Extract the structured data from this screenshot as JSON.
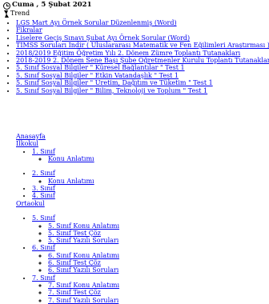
{
  "header": {
    "date": "Cuma , 5 Şubat 2021",
    "trend": "Trend"
  },
  "news": [
    "LGS Mart Ayı Örnek Sorular Düzenlenmiş (Word)",
    "Fikralar",
    "Liselere Geçiş Sınavı Şubat Ayı Örnek Sorular (Word)",
    "TIMSS Soruları İndir ( Uluslararası Matematik ve Fen Eğilimleri Araştırması )",
    "2018/2019 Eğitim Öğretim Yılı 2. Dönem Zümre Toplantı Tutanakları",
    "2018-2019 2. Dönem Sene Başı Şube Öğretmenler Kurulu Toplantı Tutanakları",
    "5. Sınıf Sosyal Bilgiler \" Küresel Bağlantılar \" Test 1",
    "5. Sınıf Sosyal Bilgiler \" Etkin Vatandaşlık \" Test 1",
    "5. Sınıf Sosyal Bilgiler \" Üretim, Dağıtım ve Tüketim \" Test 1",
    "5. Sınıf Sosyal Bilgiler \" Bilim, Teknoloji ve Toplum \" Test 1"
  ],
  "menu": {
    "home": "Anasayfa",
    "ilkokul": "İlkokul",
    "s1": "1. Sınıf",
    "s1_konu": "Konu Anlatımı",
    "s2": "2. Sınıf",
    "s2_konu": "Konu Anlatımı",
    "s3": "3. Sınıf",
    "s4": "4. Sınıf",
    "ortaokul": "Ortaokul",
    "s5": "5. Sınıf",
    "s5_konu": "5. Sınıf Konu Anlatımı",
    "s5_test": "5. Sınıf Test Çöz",
    "s5_yazili": "5. Sınıf Yazılı Soruları",
    "s6": "6. Sınıf",
    "s6_konu": "6. Sınıf Konu Anlatımı",
    "s6_test": "6. Sınıf Test Çöz",
    "s6_yazili": "6. Sınıf Yazılı Soruları",
    "s7": "7. Sınıf",
    "s7_konu": "7. Sınıf Konu Anlatımı",
    "s7_test": "7. Sınıf Test Çöz",
    "s7_yazili": "7. Sınıf Yazılı Soruları"
  }
}
